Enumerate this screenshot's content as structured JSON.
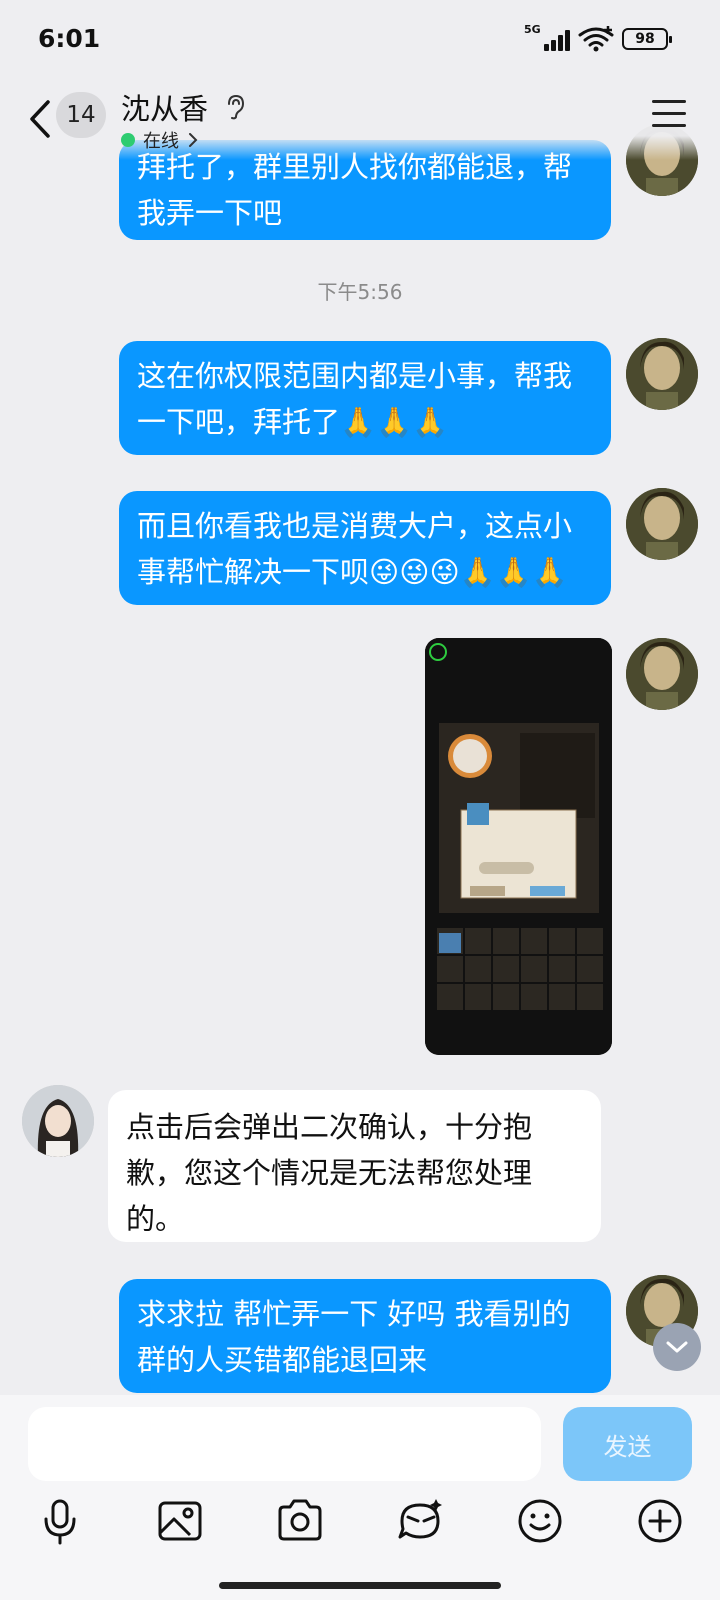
{
  "status_bar": {
    "time": "6:01",
    "network": "5G",
    "battery": "98"
  },
  "header": {
    "unread_count": "14",
    "contact_name": "沈从香",
    "status": "在线"
  },
  "messages": {
    "m1": "拜托了，群里别人找你都能退，帮我弄一下吧",
    "timestamp": "下午5:56",
    "m2": "这在你权限范围内都是小事，帮我一下吧，拜托了🙏🙏🙏",
    "m3": "而且你看我也是消费大户，这点小事帮忙解决一下呗😜😜😜🙏🙏🙏",
    "reply": "点击后会弹出二次确认，十分抱歉，您这个情况是无法帮您处理的。",
    "m4": "求求拉 帮忙弄一下 好吗 我看别的群的人买错都能退回来"
  },
  "input": {
    "placeholder": "",
    "send_label": "发送"
  },
  "colors": {
    "bubble_out": "#0a97ff",
    "bubble_in": "#ffffff",
    "background": "#eeeef1",
    "send_disabled": "#7cc6f9"
  },
  "toolbar": [
    "microphone-icon",
    "image-icon",
    "camera-icon",
    "sticker-icon",
    "emoji-icon",
    "plus-icon"
  ]
}
